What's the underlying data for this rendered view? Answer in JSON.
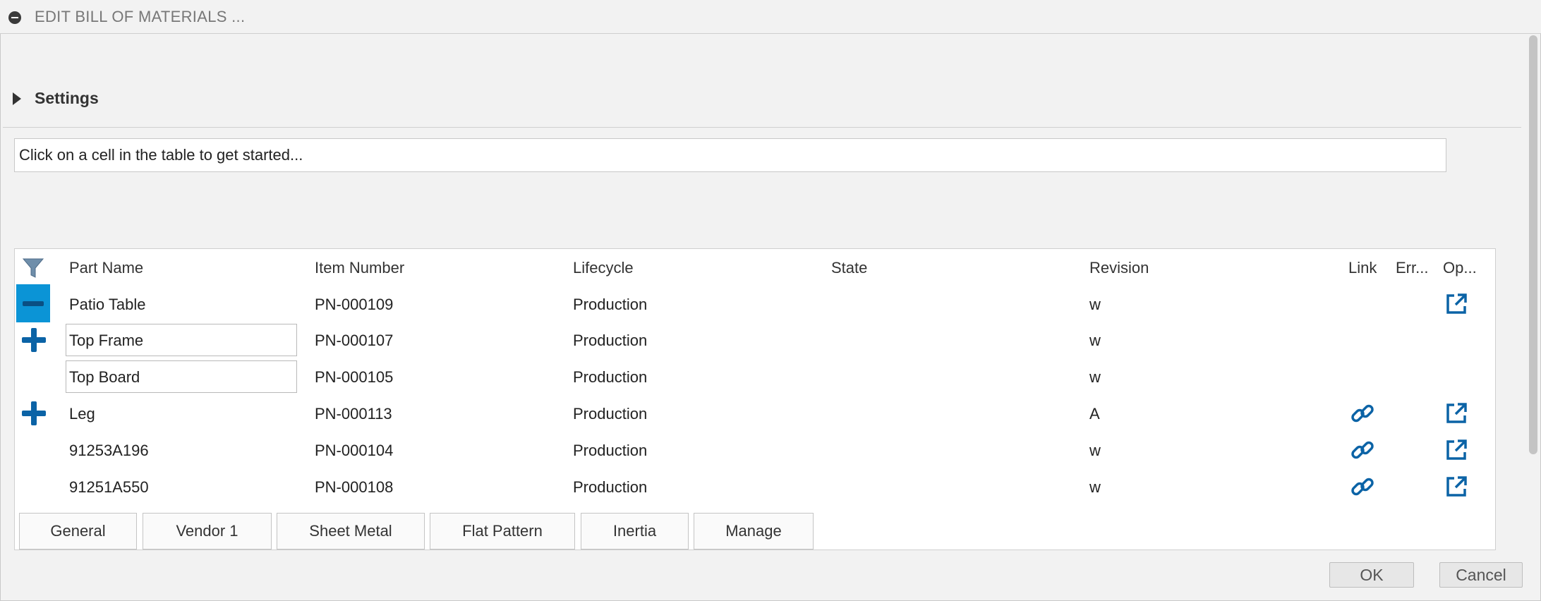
{
  "window": {
    "title": "EDIT BILL OF MATERIALS ..."
  },
  "settings": {
    "label": "Settings"
  },
  "hint": {
    "text": "Click on a cell in the table to get started..."
  },
  "table": {
    "headers": {
      "part_name": "Part Name",
      "item_number": "Item Number",
      "lifecycle": "Lifecycle",
      "state": "State",
      "revision": "Revision",
      "link": "Link",
      "errors": "Err...",
      "open": "Op..."
    },
    "rows": [
      {
        "part_name": "Patio Table",
        "item_number": "PN-000109",
        "lifecycle": "Production",
        "state": "",
        "revision": "w",
        "control": "collapse-icon",
        "link": false,
        "open": true
      },
      {
        "part_name": "Top Frame",
        "item_number": "PN-000107",
        "lifecycle": "Production",
        "state": "",
        "revision": "w",
        "control": "expand-icon",
        "link": false,
        "open": false
      },
      {
        "part_name": "Top Board",
        "item_number": "PN-000105",
        "lifecycle": "Production",
        "state": "",
        "revision": "w",
        "control": "",
        "link": false,
        "open": false
      },
      {
        "part_name": "Leg",
        "item_number": "PN-000113",
        "lifecycle": "Production",
        "state": "",
        "revision": "A",
        "control": "expand-icon",
        "link": true,
        "open": true
      },
      {
        "part_name": "91253A196",
        "item_number": "PN-000104",
        "lifecycle": "Production",
        "state": "",
        "revision": "w",
        "control": "",
        "link": true,
        "open": true
      },
      {
        "part_name": "91251A550",
        "item_number": "PN-000108",
        "lifecycle": "Production",
        "state": "",
        "revision": "w",
        "control": "",
        "link": true,
        "open": true
      }
    ]
  },
  "tabs": [
    "General",
    "Vendor 1",
    "Sheet Metal",
    "Flat Pattern",
    "Inertia",
    "Manage"
  ],
  "buttons": {
    "ok": "OK",
    "cancel": "Cancel"
  },
  "colors": {
    "accent": "#0b94d6",
    "icon_blue": "#0b63a6"
  }
}
